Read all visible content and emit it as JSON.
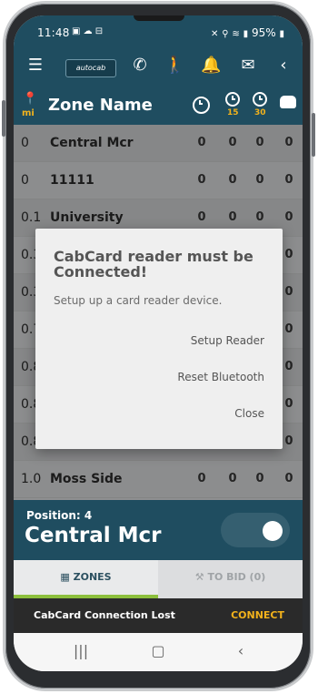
{
  "status_bar": {
    "time": "11:48",
    "left_icons": "▣ ☁ ⊟",
    "battery": "95%"
  },
  "toolbar": {
    "logo_text": "autocab",
    "icons": [
      "menu-icon",
      "phone-icon",
      "walking-icon",
      "alarm-icon",
      "mail-icon",
      "back-chevron-icon"
    ]
  },
  "header": {
    "title": "Zone Name",
    "distance_unit": "mi",
    "col_15": "15",
    "col_30": "30"
  },
  "zones": [
    {
      "distance": "0",
      "name": "Central Mcr",
      "counts": [
        "0",
        "0",
        "0",
        "0"
      ]
    },
    {
      "distance": "0",
      "name": "11111",
      "counts": [
        "0",
        "0",
        "0",
        "0"
      ]
    },
    {
      "distance": "0.1",
      "name": "University",
      "counts": [
        "0",
        "0",
        "0",
        "0"
      ]
    },
    {
      "distance": "0.3",
      "name": "",
      "counts": [
        "",
        "",
        "",
        "0"
      ]
    },
    {
      "distance": "0.3",
      "name": "",
      "counts": [
        "",
        "",
        "",
        "0"
      ]
    },
    {
      "distance": "0.7",
      "name": "",
      "counts": [
        "",
        "",
        "",
        "0"
      ]
    },
    {
      "distance": "0.8",
      "name": "",
      "counts": [
        "",
        "",
        "",
        "0"
      ]
    },
    {
      "distance": "0.8",
      "name": "",
      "counts": [
        "",
        "",
        "",
        "0"
      ]
    },
    {
      "distance": "0.8",
      "name": "",
      "counts": [
        "",
        "",
        "",
        "0"
      ]
    },
    {
      "distance": "1.0",
      "name": "Moss Side",
      "counts": [
        "0",
        "0",
        "0",
        "0"
      ]
    }
  ],
  "dialog": {
    "title": "CabCard reader must be Connected!",
    "message": "Setup up a card reader device.",
    "buttons": [
      "Setup Reader",
      "Reset Bluetooth",
      "Close"
    ]
  },
  "position": {
    "label": "Position: 4",
    "zone": "Central Mcr",
    "toggle_on": true
  },
  "tabs": [
    {
      "label": "ZONES",
      "active": true
    },
    {
      "label": "TO BID (0)",
      "active": false
    }
  ],
  "snackbar": {
    "message": "CabCard Connection Lost",
    "action": "CONNECT"
  },
  "colors": {
    "primary": "#1f4d60",
    "accent": "#f2b21c",
    "tab_indicator": "#8cbf3c"
  }
}
